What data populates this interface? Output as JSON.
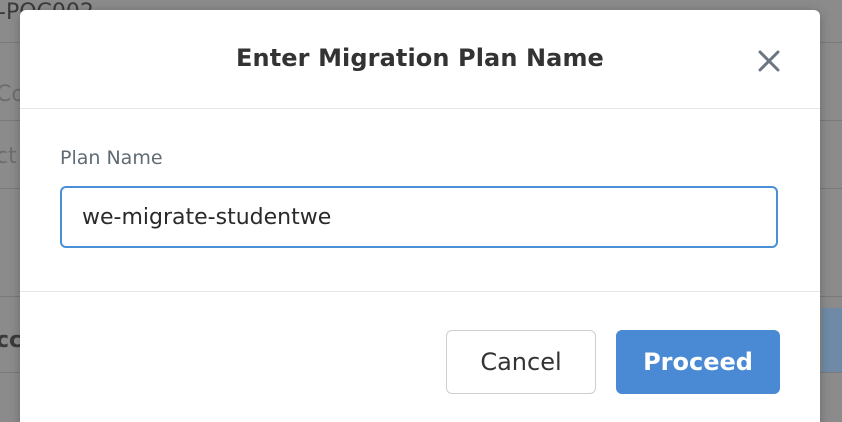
{
  "background": {
    "partial_text_top_left": "-POC002",
    "partial_text_row1": "Co",
    "partial_text_row2": "ct",
    "partial_text_row3": "cc"
  },
  "modal": {
    "title": "Enter Migration Plan Name",
    "close_icon": "close-icon",
    "field_label": "Plan Name",
    "input_value": "we-migrate-studentwe",
    "cancel_label": "Cancel",
    "proceed_label": "Proceed"
  },
  "colors": {
    "accent": "#4a8ad4",
    "input_border": "#4a90d9",
    "title": "#333333",
    "label": "#5f6b75"
  }
}
